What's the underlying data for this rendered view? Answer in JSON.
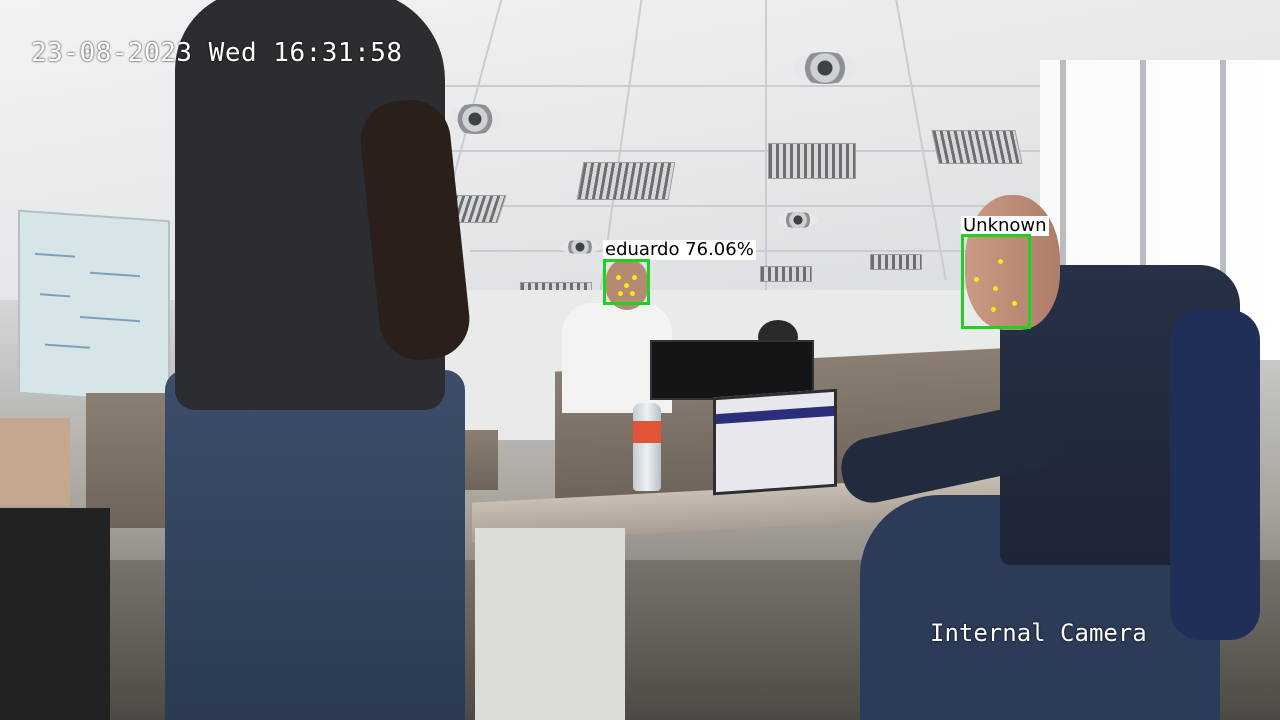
{
  "overlay": {
    "timestamp": "23-08-2023 Wed 16:31:58",
    "camera_name": "Internal Camera"
  },
  "detections": [
    {
      "label": "eduardo 76.06%",
      "box_color": "#1fd21f"
    },
    {
      "label": "Unknown",
      "box_color": "#1fd21f"
    }
  ],
  "colors": {
    "landmark": "#f5ea14",
    "box": "#1fd21f",
    "text": "#ffffff"
  }
}
